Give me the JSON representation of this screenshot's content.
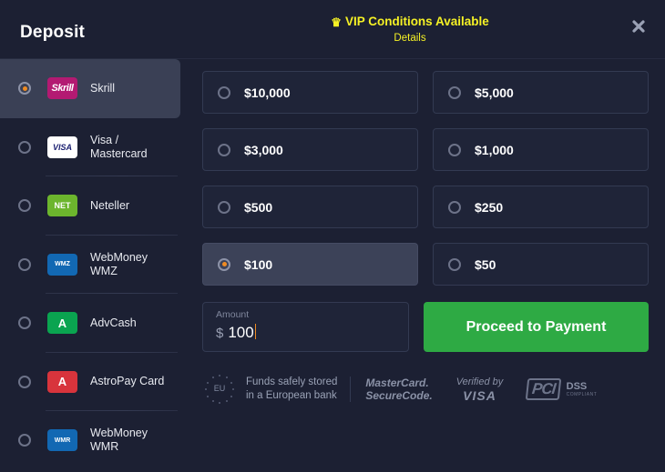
{
  "header": {
    "title": "Deposit",
    "vip_text": "VIP Conditions Available",
    "vip_details": "Details",
    "crown_icon": "crown-icon",
    "close_icon": "close-icon",
    "vip_color": "#f5f125"
  },
  "sidebar": {
    "methods": [
      {
        "label": "Skrill",
        "logo_text": "Skrill",
        "logo": "skrill-logo",
        "selected": true
      },
      {
        "label": "Visa /\nMastercard",
        "logo_text": "VISA",
        "logo": "visa-mastercard-logo",
        "selected": false
      },
      {
        "label": "Neteller",
        "logo_text": "NET",
        "logo": "neteller-logo",
        "selected": false
      },
      {
        "label": "WebMoney\nWMZ",
        "logo_text": "WMZ",
        "logo": "webmoney-wmz-logo",
        "selected": false
      },
      {
        "label": "AdvCash",
        "logo_text": "A",
        "logo": "advcash-logo",
        "selected": false
      },
      {
        "label": "AstroPay Card",
        "logo_text": "A",
        "logo": "astropay-logo",
        "selected": false
      },
      {
        "label": "WebMoney\nWMR",
        "logo_text": "WMR",
        "logo": "webmoney-wmr-logo",
        "selected": false
      }
    ]
  },
  "amounts": [
    {
      "label": "$10,000",
      "selected": false
    },
    {
      "label": "$5,000",
      "selected": false
    },
    {
      "label": "$3,000",
      "selected": false
    },
    {
      "label": "$1,000",
      "selected": false
    },
    {
      "label": "$500",
      "selected": false
    },
    {
      "label": "$250",
      "selected": false
    },
    {
      "label": "$100",
      "selected": true
    },
    {
      "label": "$50",
      "selected": false
    }
  ],
  "amount_field": {
    "caption": "Amount",
    "currency": "$",
    "value": "100"
  },
  "cta": {
    "label": "Proceed to Payment",
    "color": "#2eaa44"
  },
  "trust": {
    "eu_badge_text": "EU",
    "eu_caption": "Funds safely stored\nin a European bank",
    "mastercard": "MasterCard.\nSecureCode.",
    "visa_line1": "Verified by",
    "visa_line2": "VISA",
    "pci_mark": "PCI",
    "pci_dss": "DSS",
    "pci_sub": "COMPLIANT"
  }
}
